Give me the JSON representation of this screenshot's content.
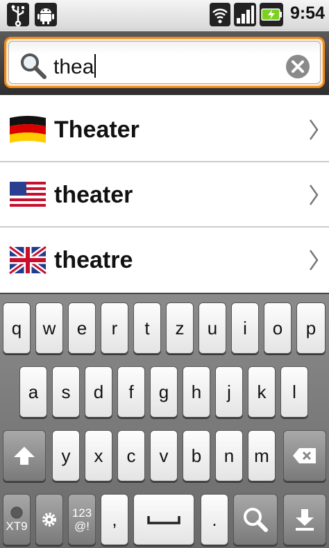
{
  "status_bar": {
    "time": "9:54",
    "icons": [
      "usb-icon",
      "android-debug-icon",
      "wifi-icon",
      "signal-icon",
      "battery-charging-icon"
    ]
  },
  "search": {
    "query": "thea",
    "search_icon": "magnifier-icon",
    "clear_icon": "clear-icon"
  },
  "results": [
    {
      "word": "Theater",
      "flag": "germany-flag-icon"
    },
    {
      "word": "theater",
      "flag": "usa-flag-icon"
    },
    {
      "word": "theatre",
      "flag": "uk-flag-icon"
    }
  ],
  "keyboard": {
    "row1": [
      "q",
      "w",
      "e",
      "r",
      "t",
      "z",
      "u",
      "i",
      "o",
      "p"
    ],
    "row2": [
      "a",
      "s",
      "d",
      "f",
      "g",
      "h",
      "j",
      "k",
      "l"
    ],
    "row3": [
      "y",
      "x",
      "c",
      "v",
      "b",
      "n",
      "m"
    ],
    "xt9_label": "XT9",
    "num_label_top": "123",
    "num_label_bottom": "@!",
    "comma": ",",
    "period": "."
  },
  "colors": {
    "search_border": "#f08a1c",
    "keyboard_bg": "#7a7a7a"
  }
}
